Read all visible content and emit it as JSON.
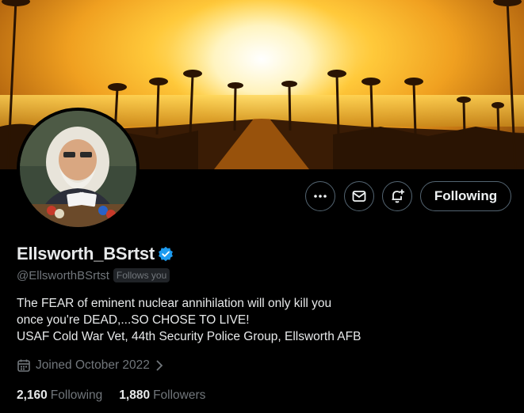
{
  "profile": {
    "display_name": "Ellsworth_BSrtst",
    "handle": "@EllsworthBSrtst",
    "follows_you_badge": "Follows you",
    "verified": true,
    "bio_lines": [
      "The FEAR of eminent nuclear annihilation will only kill you",
      "once you're DEAD,...SO CHOSE TO LIVE!",
      "USAF Cold War Vet, 44th Security Police Group, Ellsworth AFB"
    ],
    "joined": "Joined October 2022",
    "stats": {
      "following_count": "2,160",
      "following_label": "Following",
      "followers_count": "1,880",
      "followers_label": "Followers"
    }
  },
  "actions": {
    "more_icon": "more-horizontal-icon",
    "message_icon": "mail-icon",
    "notify_icon": "bell-plus-icon",
    "follow_button_label": "Following"
  },
  "colors": {
    "background": "#000000",
    "text_primary": "#e7e9ea",
    "text_secondary": "#71767b",
    "verified_blue": "#1d9bf0",
    "button_border": "#536471"
  }
}
